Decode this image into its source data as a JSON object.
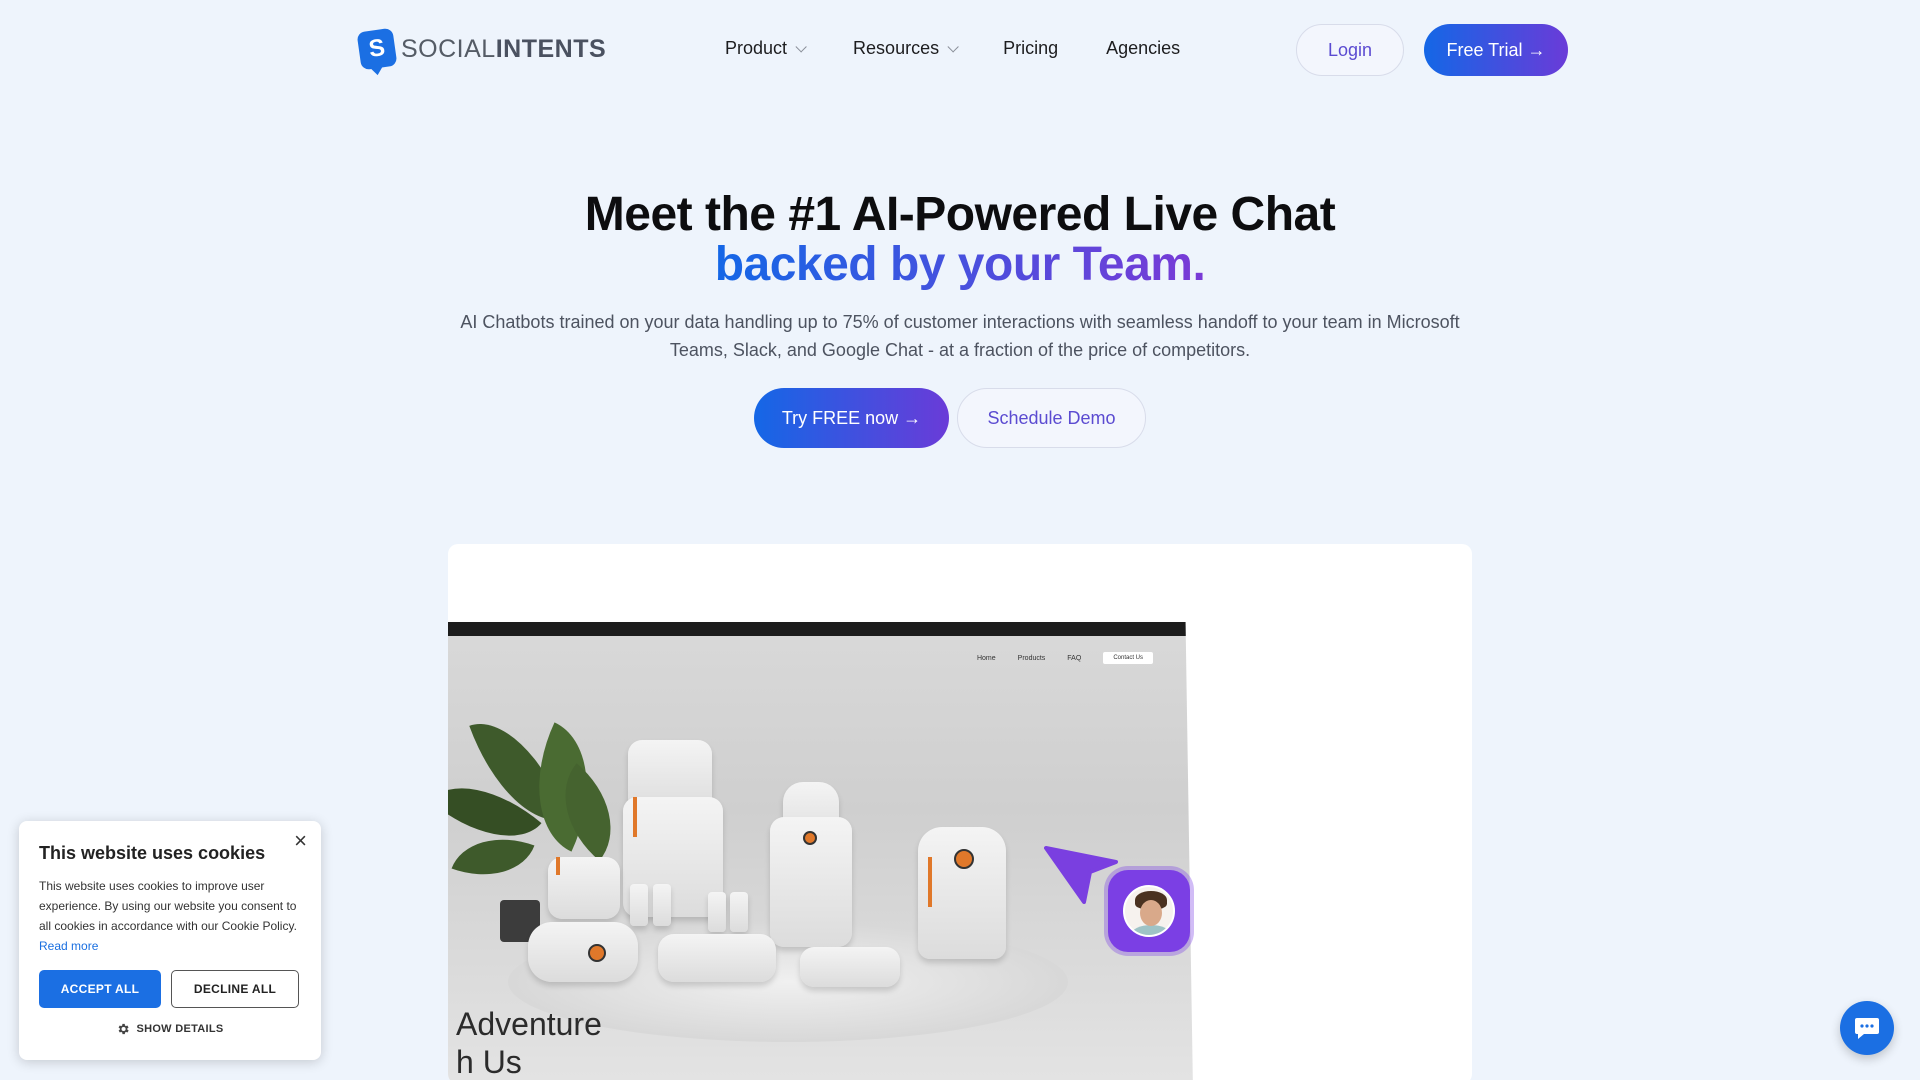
{
  "brand": {
    "logo_bold": "INTENTS",
    "logo_light": "SOCIAL",
    "color_primary": "#1b6fe3",
    "color_accent": "#6a3bd8"
  },
  "nav": {
    "items": [
      {
        "label": "Product",
        "has_dropdown": true
      },
      {
        "label": "Resources",
        "has_dropdown": true
      },
      {
        "label": "Pricing",
        "has_dropdown": false
      },
      {
        "label": "Agencies",
        "has_dropdown": false
      }
    ],
    "login_label": "Login",
    "trial_label": "Free Trial →"
  },
  "hero": {
    "title_line1": "Meet the #1 AI-Powered Live Chat",
    "title_line2": "backed by your Team.",
    "subtitle": "AI Chatbots trained on your data handling up to 75% of customer interactions with seamless handoff to your team in Microsoft Teams, Slack, and Google Chat - at a fraction of the price of competitors.",
    "cta_primary": "Try FREE now →",
    "cta_secondary": "Schedule Demo"
  },
  "demo": {
    "mock_nav": [
      "Home",
      "Products",
      "FAQ"
    ],
    "mock_contact": "Contact Us",
    "mock_headline_line1": "Adventure",
    "mock_headline_line2": "h Us"
  },
  "cookie": {
    "title": "This website uses cookies",
    "text": "This website uses cookies to improve user experience. By using our website you consent to all cookies in accordance with our Cookie Policy.",
    "read_more": "Read more",
    "accept_label": "ACCEPT ALL",
    "decline_label": "DECLINE ALL",
    "details_label": "SHOW DETAILS",
    "close_label": "×"
  },
  "icons": {
    "chevron": "chevron-down-icon",
    "gear": "gear-icon",
    "chat": "chat-icon",
    "close": "close-icon"
  }
}
